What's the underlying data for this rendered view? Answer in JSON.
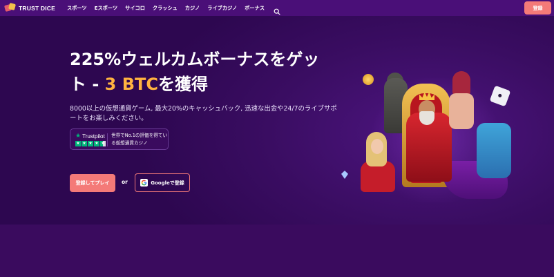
{
  "brand": {
    "name": "TRUST DICE"
  },
  "nav": {
    "items": [
      {
        "label": "スポーツ"
      },
      {
        "label": "Eスポーツ"
      },
      {
        "label": "サイコロ"
      },
      {
        "label": "クラッシュ"
      },
      {
        "label": "カジノ"
      },
      {
        "label": "ライブカジノ"
      },
      {
        "label": "ボーナス"
      }
    ],
    "search_icon": "search-icon",
    "register_label": "登録"
  },
  "hero": {
    "headline_part1": "225%ウェルカムボーナスをゲット - ",
    "headline_accent": "3 BTC",
    "headline_part2": "を獲得",
    "subtext": "8000以上の仮想通貨ゲーム, 最大20%のキャッシュバック, 迅速な出金や24/7のライブサポートをお楽しみください。",
    "trustpilot": {
      "name": "Trustpilot",
      "rating_stars": 4.5,
      "text": "世界でNo.1の評価を得ている仮想通貨カジノ"
    },
    "play_label": "登録してプレイ",
    "or_label": "or",
    "google_label": "Googleで登録"
  },
  "colors": {
    "accent": "#f47a78",
    "highlight": "#ffb340",
    "background": "#3a0b5e",
    "nav": "#4a0f78",
    "trustpilot_green": "#00b67a"
  }
}
